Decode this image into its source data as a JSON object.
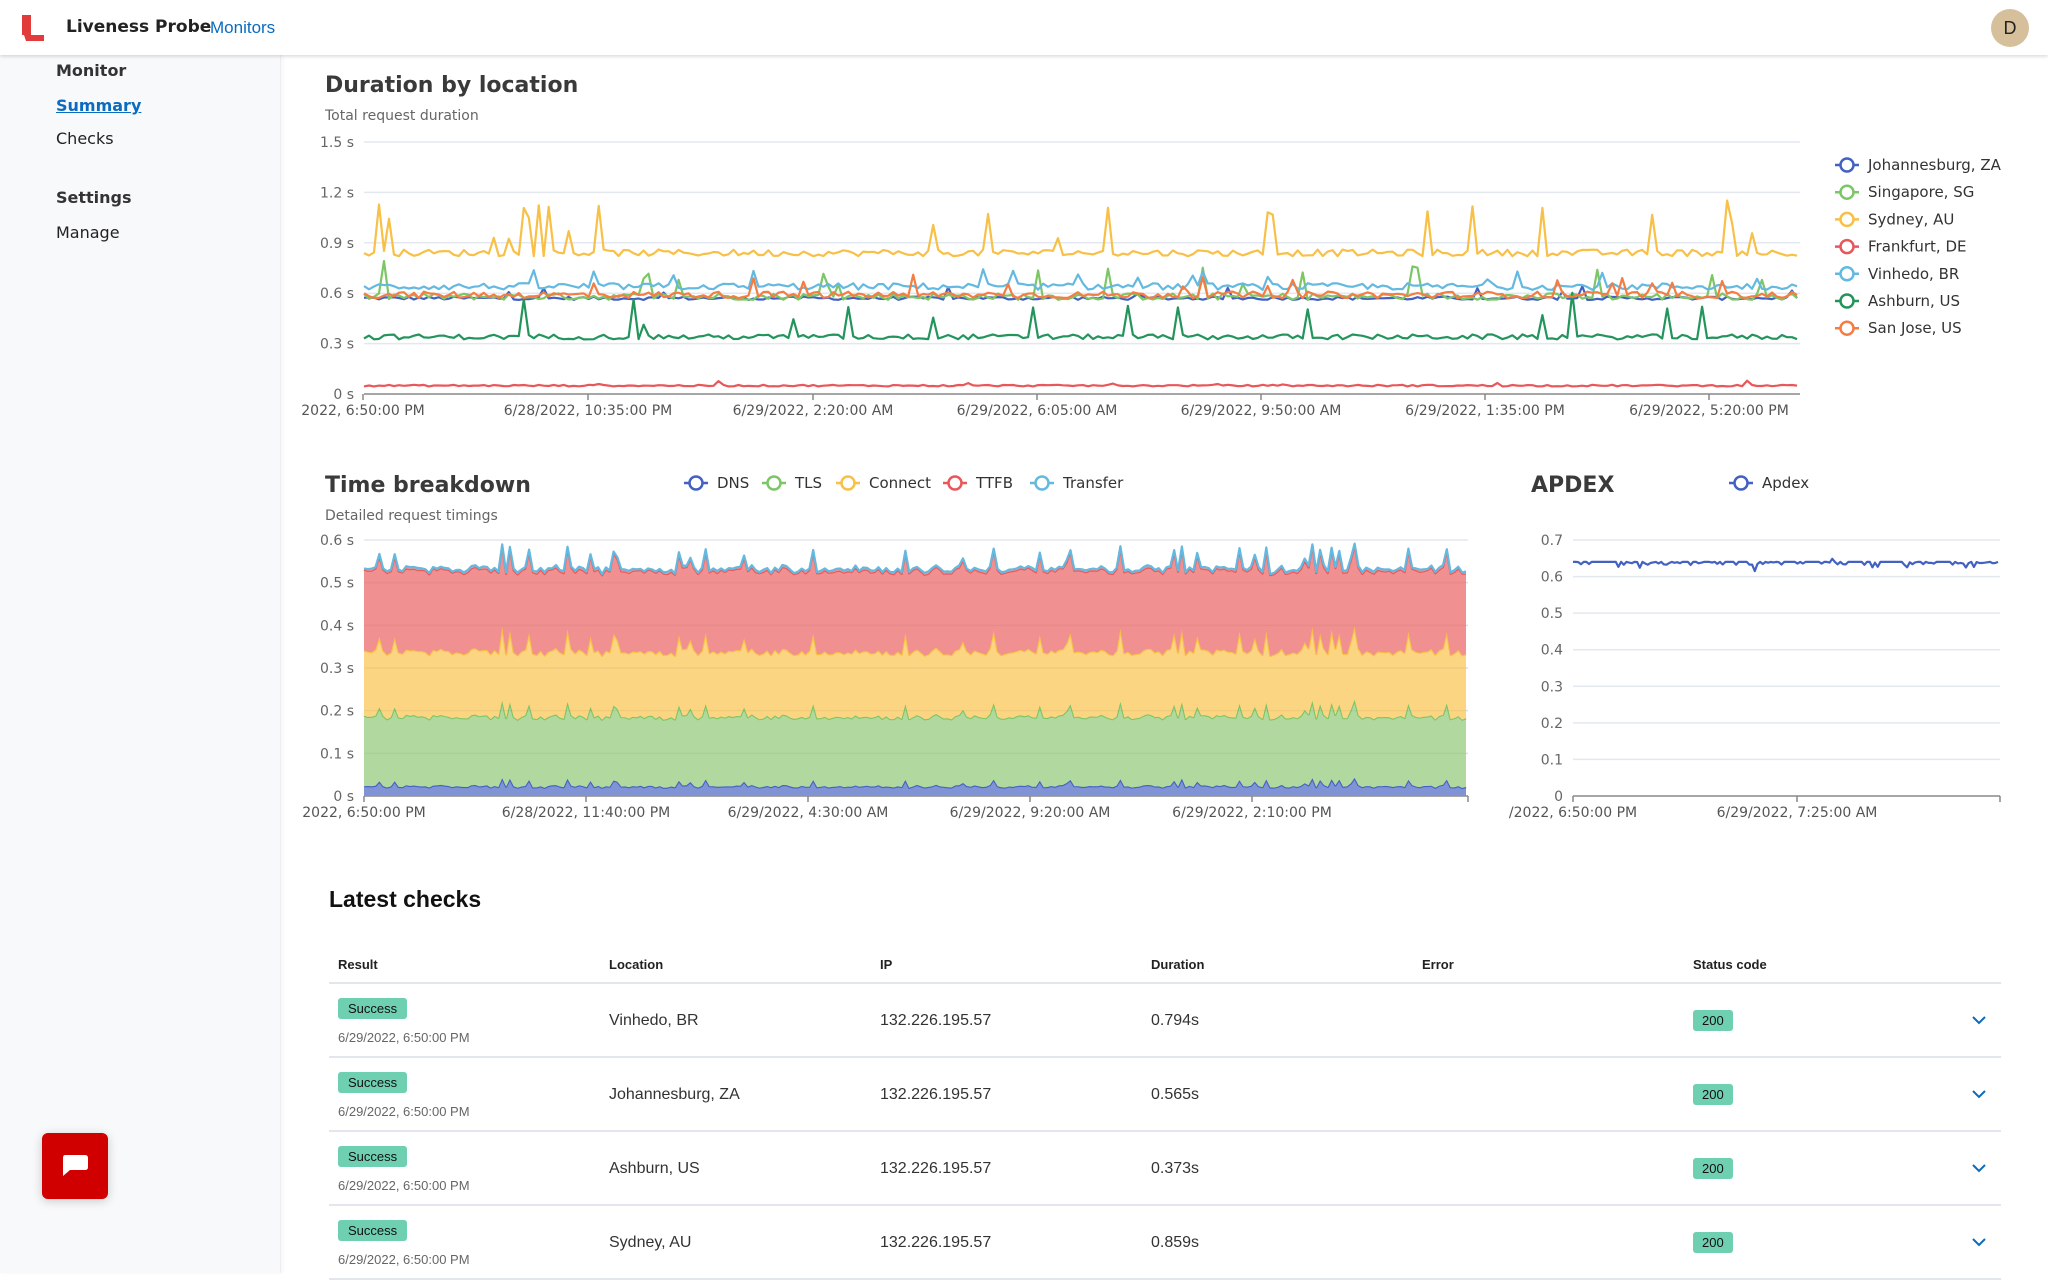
{
  "header": {
    "app_title": "Liveness Probe",
    "nav_link": "Monitors",
    "avatar_initial": "D"
  },
  "sidebar": {
    "sections": [
      {
        "heading": "Monitor",
        "items": [
          {
            "label": "Summary",
            "active": true
          },
          {
            "label": "Checks",
            "active": false
          }
        ]
      },
      {
        "heading": "Settings",
        "items": [
          {
            "label": "Manage",
            "active": false
          }
        ]
      }
    ]
  },
  "chat_button": {
    "icon": "chat-bubble-icon"
  },
  "chart_data": [
    {
      "id": "duration",
      "type": "line",
      "title": "Duration by location",
      "subtitle": "Total request duration",
      "xlabel": "",
      "ylabel": "",
      "ylim": [
        0,
        1.5
      ],
      "yticks": [
        "0 s",
        "0.3 s",
        "0.6 s",
        "0.9 s",
        "1.2 s",
        "1.5 s"
      ],
      "ytick_values": [
        0,
        0.3,
        0.6,
        0.9,
        1.2,
        1.5
      ],
      "xticks": [
        "2022, 6:50:00 PM",
        "6/28/2022, 10:35:00 PM",
        "6/29/2022, 2:20:00 AM",
        "6/29/2022, 6:05:00 AM",
        "6/29/2022, 9:50:00 AM",
        "6/29/2022, 1:35:00 PM",
        "6/29/2022, 5:20:00 PM"
      ],
      "grid": true,
      "legend_position": "right",
      "points": 288,
      "series": [
        {
          "name": "Johannesburg, ZA",
          "color": "#4361c2",
          "base": 0.57,
          "noise": 0.01,
          "spike": 0.08,
          "spike_rate": 0.03
        },
        {
          "name": "Singapore, SG",
          "color": "#7cc665",
          "base": 0.58,
          "noise": 0.02,
          "spike": 0.2,
          "spike_rate": 0.05
        },
        {
          "name": "Sydney, AU",
          "color": "#f8c046",
          "base": 0.84,
          "noise": 0.02,
          "spike": 0.3,
          "spike_rate": 0.08
        },
        {
          "name": "Frankfurt, DE",
          "color": "#e8585b",
          "base": 0.05,
          "noise": 0.005,
          "spike": 0.03,
          "spike_rate": 0.05
        },
        {
          "name": "Vinhedo, BR",
          "color": "#64b9e0",
          "base": 0.64,
          "noise": 0.02,
          "spike": 0.1,
          "spike_rate": 0.06
        },
        {
          "name": "Ashburn, US",
          "color": "#23955c",
          "base": 0.34,
          "noise": 0.015,
          "spike": 0.25,
          "spike_rate": 0.08
        },
        {
          "name": "San Jose, US",
          "color": "#f57d43",
          "base": 0.59,
          "noise": 0.02,
          "spike": 0.12,
          "spike_rate": 0.04
        }
      ]
    },
    {
      "id": "breakdown",
      "type": "area",
      "stacked": true,
      "title": "Time breakdown",
      "subtitle": "Detailed request timings",
      "xlabel": "",
      "ylabel": "",
      "ylim": [
        0,
        0.6
      ],
      "yticks": [
        "0 s",
        "0.1 s",
        "0.2 s",
        "0.3 s",
        "0.4 s",
        "0.5 s",
        "0.6 s"
      ],
      "ytick_values": [
        0,
        0.1,
        0.2,
        0.3,
        0.4,
        0.5,
        0.6
      ],
      "xticks": [
        "2022, 6:50:00 PM",
        "6/28/2022, 11:40:00 PM",
        "6/29/2022, 4:30:00 AM",
        "6/29/2022, 9:20:00 AM",
        "6/29/2022, 2:10:00 PM"
      ],
      "grid": true,
      "legend_position": "top",
      "points": 288,
      "series": [
        {
          "name": "DNS",
          "color": "#4361c2",
          "fill": "#8093d5",
          "base": 0.02
        },
        {
          "name": "TLS",
          "color": "#7cc665",
          "fill": "#b1d99f",
          "base": 0.16
        },
        {
          "name": "Connect",
          "color": "#f8c046",
          "fill": "#fbd581",
          "base": 0.15
        },
        {
          "name": "TTFB",
          "color": "#e8585b",
          "fill": "#f09090",
          "base": 0.19
        },
        {
          "name": "Transfer",
          "color": "#64b9e0",
          "fill": "#f09090",
          "base": 0.004
        }
      ]
    },
    {
      "id": "apdex",
      "type": "line",
      "title": "APDEX",
      "subtitle": "",
      "xlabel": "",
      "ylabel": "",
      "ylim": [
        0,
        0.7
      ],
      "yticks": [
        "0",
        "0.1",
        "0.2",
        "0.3",
        "0.4",
        "0.5",
        "0.6",
        "0.7"
      ],
      "ytick_values": [
        0,
        0.1,
        0.2,
        0.3,
        0.4,
        0.5,
        0.6,
        0.7
      ],
      "xticks": [
        "/2022, 6:50:00 PM",
        "6/29/2022, 7:25:00 AM"
      ],
      "grid": true,
      "legend_position": "top",
      "points": 160,
      "series": [
        {
          "name": "Apdex",
          "color": "#4361c2",
          "base": 0.64,
          "dip": 0.02
        }
      ]
    }
  ],
  "latest_checks": {
    "title": "Latest checks",
    "columns": [
      "Result",
      "Location",
      "IP",
      "Duration",
      "Error",
      "Status code"
    ],
    "rows": [
      {
        "result": "Success",
        "time": "6/29/2022, 6:50:00 PM",
        "location": "Vinhedo, BR",
        "ip": "132.226.195.57",
        "duration": "0.794s",
        "error": "",
        "status": "200"
      },
      {
        "result": "Success",
        "time": "6/29/2022, 6:50:00 PM",
        "location": "Johannesburg, ZA",
        "ip": "132.226.195.57",
        "duration": "0.565s",
        "error": "",
        "status": "200"
      },
      {
        "result": "Success",
        "time": "6/29/2022, 6:50:00 PM",
        "location": "Ashburn, US",
        "ip": "132.226.195.57",
        "duration": "0.373s",
        "error": "",
        "status": "200"
      },
      {
        "result": "Success",
        "time": "6/29/2022, 6:50:00 PM",
        "location": "Sydney, AU",
        "ip": "132.226.195.57",
        "duration": "0.859s",
        "error": "",
        "status": "200"
      }
    ]
  }
}
